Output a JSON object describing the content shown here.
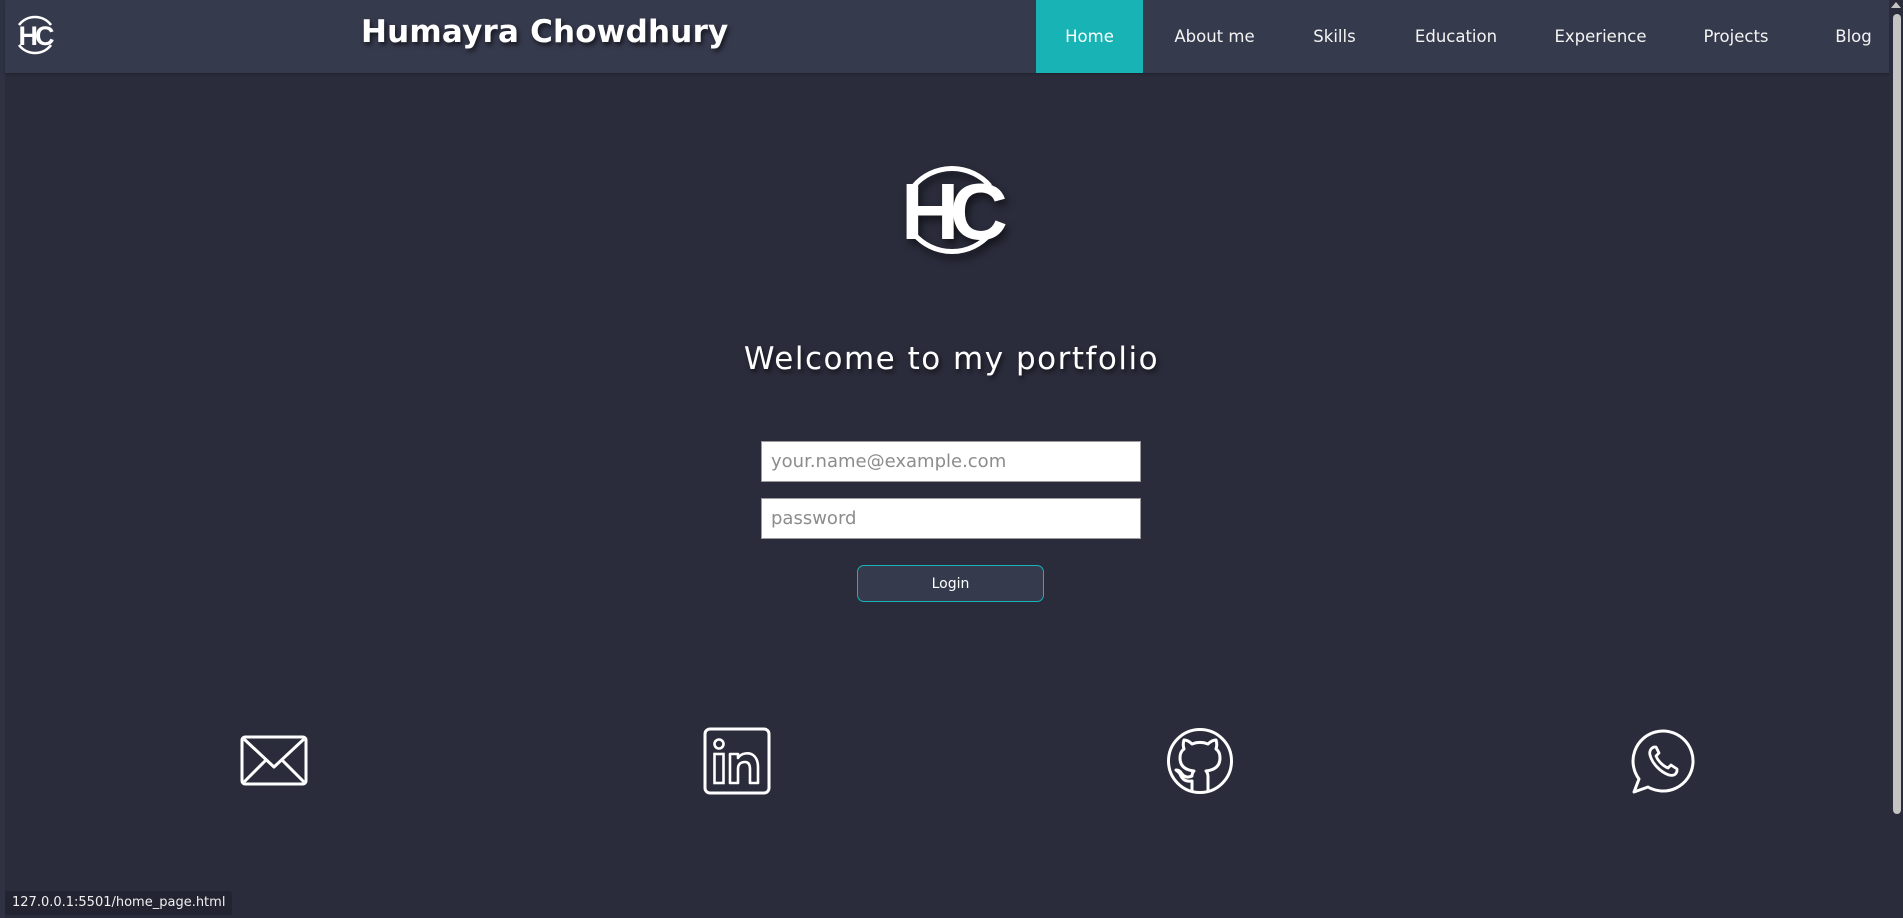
{
  "navbar": {
    "logo_text": "HC",
    "brand_name": "Humayra Chowdhury",
    "links": [
      {
        "label": "Home",
        "active": true
      },
      {
        "label": "About me",
        "active": false
      },
      {
        "label": "Skills",
        "active": false
      },
      {
        "label": "Education",
        "active": false
      },
      {
        "label": "Experience",
        "active": false
      },
      {
        "label": "Projects",
        "active": false
      },
      {
        "label": "Blog",
        "active": false
      }
    ]
  },
  "hero": {
    "logo_text": "HC",
    "welcome_text": "Welcome to my portfolio"
  },
  "login_form": {
    "email_placeholder": "your.name@example.com",
    "password_placeholder": "password",
    "login_label": "Login"
  },
  "social": [
    {
      "icon": "email-icon"
    },
    {
      "icon": "linkedin-icon"
    },
    {
      "icon": "github-icon"
    },
    {
      "icon": "whatsapp-icon"
    }
  ],
  "status_bar": {
    "url": "127.0.0.1:5501/home_page.html"
  },
  "colors": {
    "background": "#2a2c3b",
    "navbar": "#363a4d",
    "accent": "#17b3b5"
  }
}
